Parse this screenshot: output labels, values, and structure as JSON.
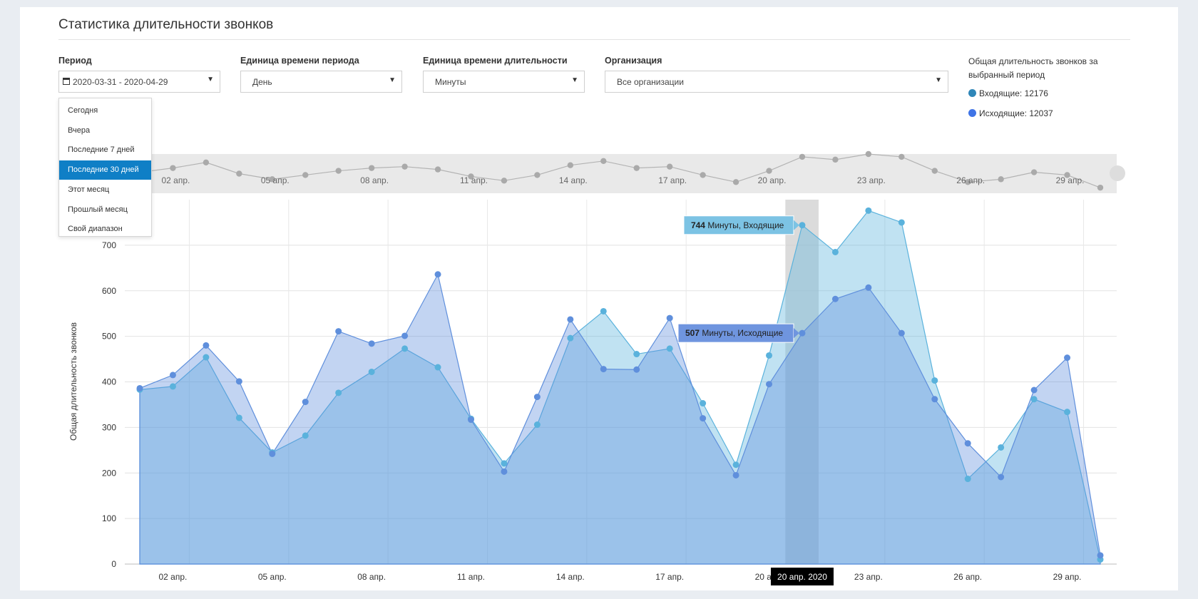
{
  "page": {
    "title": "Статистика длительности звонков"
  },
  "filters": {
    "period_label": "Период",
    "period_value": "2020-03-31 - 2020-04-29",
    "period_unit_label": "Единица времени периода",
    "period_unit_value": "День",
    "duration_unit_label": "Единица времени длительности",
    "duration_unit_value": "Минуты",
    "org_label": "Организация",
    "org_value": "Все организации"
  },
  "period_menu": {
    "items": [
      "Сегодня",
      "Вчера",
      "Последние 7 дней",
      "Последние 30 дней",
      "Этот месяц",
      "Прошлый месяц",
      "Свой диапазон"
    ],
    "active_index": 3
  },
  "summary": {
    "title": "Общая длительность звонков за выбранный период",
    "incoming_label": "Входящие: 12176",
    "outgoing_label": "Исходящие: 12037"
  },
  "colors": {
    "incoming": "#5ab2dc",
    "outgoing": "#5f8fdc",
    "active_menu": "#0f7fc6",
    "navigator": "#aaaaaa"
  },
  "tooltips": {
    "incoming": {
      "value": "744",
      "text": " Минуты, Входящие"
    },
    "outgoing": {
      "value": "507",
      "text": " Минуты, Исходящие"
    },
    "x_label": "20 апр. 2020"
  },
  "chart_data": {
    "type": "area",
    "ylabel": "Общая длительность звонков",
    "xlabel": "",
    "ylim": [
      0,
      800
    ],
    "y_ticks": [
      0,
      100,
      200,
      300,
      400,
      500,
      600,
      700
    ],
    "x_tick_labels": [
      "02 апр.",
      "05 апр.",
      "08 апр.",
      "11 апр.",
      "14 апр.",
      "17 апр.",
      "20 апр.",
      "23 апр.",
      "26 апр.",
      "29 апр."
    ],
    "x_tick_days": [
      2,
      5,
      8,
      11,
      14,
      17,
      20,
      23,
      26,
      29
    ],
    "x": [
      "2020-03-31",
      "2020-04-01",
      "2020-04-02",
      "2020-04-03",
      "2020-04-04",
      "2020-04-05",
      "2020-04-06",
      "2020-04-07",
      "2020-04-08",
      "2020-04-09",
      "2020-04-10",
      "2020-04-11",
      "2020-04-12",
      "2020-04-13",
      "2020-04-14",
      "2020-04-15",
      "2020-04-16",
      "2020-04-17",
      "2020-04-18",
      "2020-04-19",
      "2020-04-20",
      "2020-04-21",
      "2020-04-22",
      "2020-04-23",
      "2020-04-24",
      "2020-04-25",
      "2020-04-26",
      "2020-04-27",
      "2020-04-28",
      "2020-04-29"
    ],
    "highlight_date": "2020-04-20",
    "grid": true,
    "series": [
      {
        "name": "Входящие",
        "values": [
          383,
          390,
          454,
          321,
          245,
          282,
          376,
          422,
          473,
          432,
          319,
          221,
          306,
          496,
          555,
          461,
          473,
          353,
          218,
          458,
          744,
          685,
          776,
          750,
          403,
          187,
          256,
          362,
          334,
          10
        ]
      },
      {
        "name": "Исходящие",
        "values": [
          386,
          415,
          480,
          401,
          242,
          356,
          511,
          484,
          501,
          636,
          317,
          203,
          367,
          537,
          428,
          427,
          540,
          320,
          195,
          395,
          507,
          582,
          607,
          507,
          362,
          265,
          191,
          382,
          453,
          19
        ]
      }
    ],
    "navigator_values": [
      530,
      560,
      600,
      520,
      480,
      510,
      540,
      560,
      570,
      550,
      500,
      470,
      510,
      580,
      610,
      560,
      570,
      510,
      460,
      540,
      640,
      620,
      660,
      640,
      540,
      460,
      480,
      530,
      510,
      420
    ]
  }
}
